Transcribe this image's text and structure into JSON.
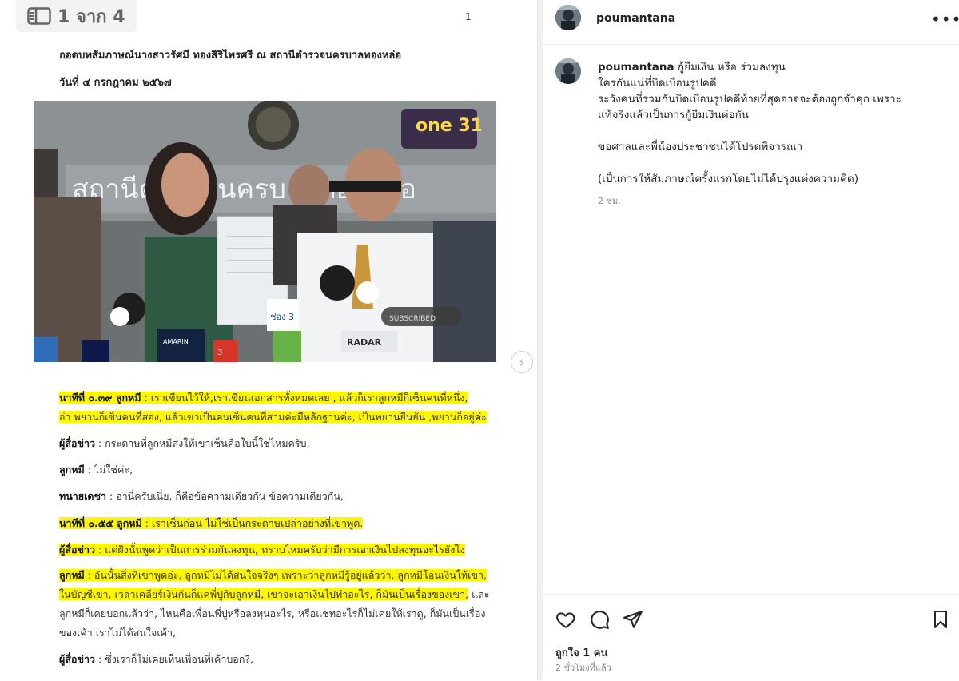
{
  "document": {
    "pager_label": "1 จาก 4",
    "page_number": "1",
    "title": "ถอดบทสัมภาษณ์นางสาวรัศมี ทองสิริไพรศรี ณ สถานีตำรวจนครบาลทองหล่อ",
    "date": "วันที่ ๔ กรกฎาคม ๒๕๖๗",
    "photo": {
      "channel_logo": "one 31",
      "building_sign": "สถานีตำรวจนครบาลทองหล่อ",
      "subscribed_label": "SUBSCRIBED",
      "mic_labels": [
        "ช่อง 3",
        "AMARIN",
        "3",
        "RADAR"
      ]
    },
    "paragraphs": [
      {
        "speaker": "นาทีที่ ๐.๓๙ ลูกหมี",
        "lines": [
          ": เราเขียนไว้ให้,เราเขียนเอกสารทั้งหมดเลย , แล้วก็เราลูกหมีก็เซ็นคนที่หนึ่ง,",
          "อ่า พยานก็เซ็นคนที่สอง, แล้วเขาเป็นคนเซ็นคนที่สามค่ะมีหลักฐานค่ะ, เป็นพยานยืนยัน ,พยานก็อยู่ค่ะ"
        ]
      },
      {
        "speaker": "ผู้สื่อข่าว",
        "lines": [
          ": กระดาษที่ลูกหมีส่งให้เขาเซ็นคือใบนี้ใช่ไหมครับ,"
        ]
      },
      {
        "speaker": "ลูกหมี",
        "lines": [
          ": ไม่ใช่ค่ะ,"
        ]
      },
      {
        "speaker": "ทนายเดชา",
        "lines": [
          ": อ่านี่ครับเนี่ย, ก็คือข้อความเดียวกัน ข้อความเดียวกัน,"
        ]
      },
      {
        "speaker": "นาทีที่ ๐.๕๕ ลูกหมี",
        "lines": [
          ": เราเซ็นก่อน ไม่ใช่เป็นกระดาษเปล่าอย่างที่เขาพูด."
        ]
      },
      {
        "speaker": "ผู้สื่อข่าว",
        "lines": [
          ": แต่ฝั่งนั้นพูดว่าเป็นการร่วมกันลงทุน, ทราบไหมครับว่ามีการเอาเงินไปลงทุนอะไรยังไง"
        ]
      },
      {
        "speaker": "ลูกหมี",
        "lines": [
          ": อันนั้นสิ่งที่เขาพูดอ่ะ, ลูกหมีไม่ได้สนใจจริงๆ เพราะว่าลูกหมีรู้อยู่แล้วว่า, ลูกหมีโอนเงินให้เขา,",
          "ในบัญชีเขา, เวลาเคลียร์เงินกันก็แค่พี่ปูกับลูกหมี, เขาจะเอาเงินไปทำอะไร, ก็มันเป็นเรื่องของเขา,",
          "และ",
          "ลูกหมีก็เคยบอกแล้วว่า, ไหนคือเพื่อนพี่ปูหรือลงทุนอะไร, หรือแชทอะไรก็ไม่เคยให้เราดู, ก็มันเป็นเรื่อง",
          "ของเค้า เราไม่ได้สนใจเค้า,"
        ]
      },
      {
        "speaker": "ผู้สื่อข่าว",
        "lines": [
          ": ซึ่งเราก็ไม่เคยเห็นเพื่อนที่เค้าบอก?,"
        ]
      }
    ]
  },
  "post": {
    "username": "poumantana",
    "caption_lines": [
      "กู้ยืมเงิน หรือ ร่วมลงทุน",
      "ใครกันแน่ที่บิดเบือนรูปคดี",
      "ระวังคนที่ร่วมกันบิดเบือนรูปคดีท้ายที่สุดอาจจะต้องถูกจำคุก เพราะ",
      "แท้จริงแล้วเป็นการกู้ยืมเงินต่อกัน",
      "",
      "ขอศาลและพี่น้องประชาชนได้โปรดพิจารณา",
      "",
      "(เป็นการให้สัมภาษณ์ครั้งแรกโดยไม่ได้ปรุงแต่งความคิด)"
    ],
    "comment_time": "2 ชม.",
    "likes": "ถูกใจ 1 คน",
    "posted_ago": "2 ชั่วโมงที่แล้ว",
    "more_icon": "•••"
  }
}
